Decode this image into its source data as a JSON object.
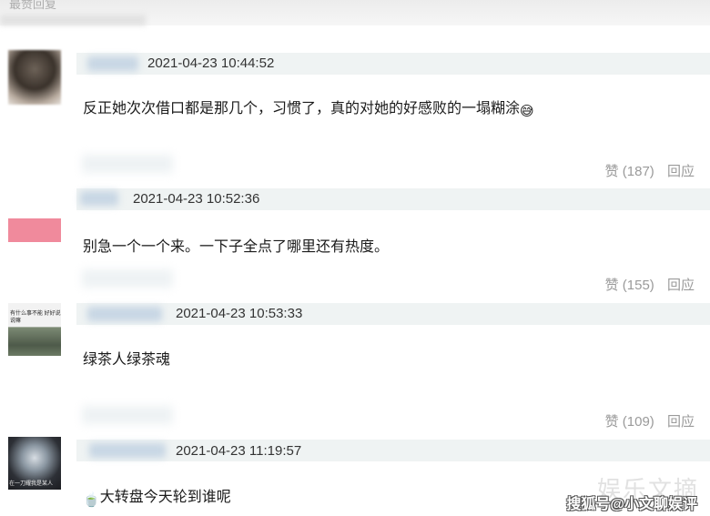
{
  "header": {
    "title": "最赞回复"
  },
  "colors": {
    "timestamp_band": "#eff3f3",
    "action_text": "#9a9a9a",
    "name_blur": "#c7d6e4"
  },
  "comments": [
    {
      "timestamp": "2021-04-23 10:44:52",
      "text": "反正她次次借口都是那几个，习惯了，真的对她的好感败的一塌糊涂",
      "emoji": "😅",
      "avatar_icon": "avatar-photo"
    },
    {
      "timestamp": "2021-04-23 10:52:36",
      "text": "别急一个一个来。一下子全点了哪里还有热度。",
      "like_label": "赞",
      "like_count": "(187)",
      "reply_label": "回应",
      "avatar_icon": "avatar-pink"
    },
    {
      "timestamp": "2021-04-23 10:53:33",
      "text": "绿茶人绿茶魂",
      "like_label": "赞",
      "like_count": "(155)",
      "reply_label": "回应",
      "avatar_icon": "avatar-sofa",
      "avatar_caption": "有什么事不能 好好说说嘛"
    },
    {
      "timestamp": "2021-04-23 11:19:57",
      "text": "大转盘今天轮到谁呢",
      "emoji": "🍵",
      "like_label": "赞",
      "like_count": "(109)",
      "reply_label": "回应",
      "avatar_icon": "avatar-ghost",
      "avatar_caption": "在一刀耀我是某人"
    }
  ],
  "watermark": {
    "text": "娱乐文摘",
    "credit": "搜狐号@小文聊娱评"
  }
}
